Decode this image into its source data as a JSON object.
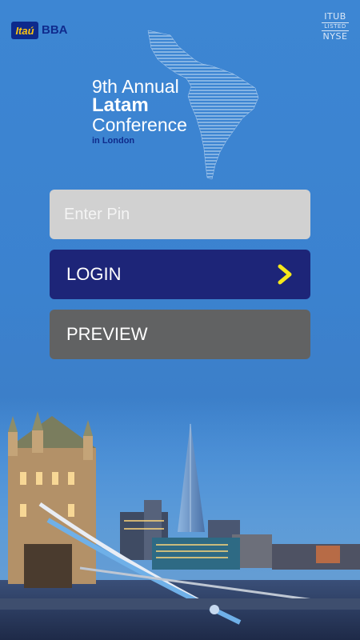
{
  "header": {
    "logo_text": "Itaú",
    "logo_suffix": "BBA",
    "ticker_top": "ITUB",
    "ticker_mid": "LISTED",
    "ticker_bottom": "NYSE"
  },
  "event": {
    "line1": "9th Annual",
    "line2": "Latam",
    "line3": "Conference",
    "line4": "in London"
  },
  "form": {
    "pin_placeholder": "Enter Pin",
    "pin_value": "",
    "login_label": "LOGIN",
    "preview_label": "PREVIEW"
  },
  "icons": {
    "login_arrow": "chevron-right-icon",
    "map": "latin-america-map-icon"
  },
  "colors": {
    "background": "#3d86d3",
    "login_button": "#1d2578",
    "preview_button": "#616263",
    "pin_field": "#d1d1d1",
    "accent_yellow": "#f5e81b",
    "brand_blue": "#0d2a8c"
  }
}
